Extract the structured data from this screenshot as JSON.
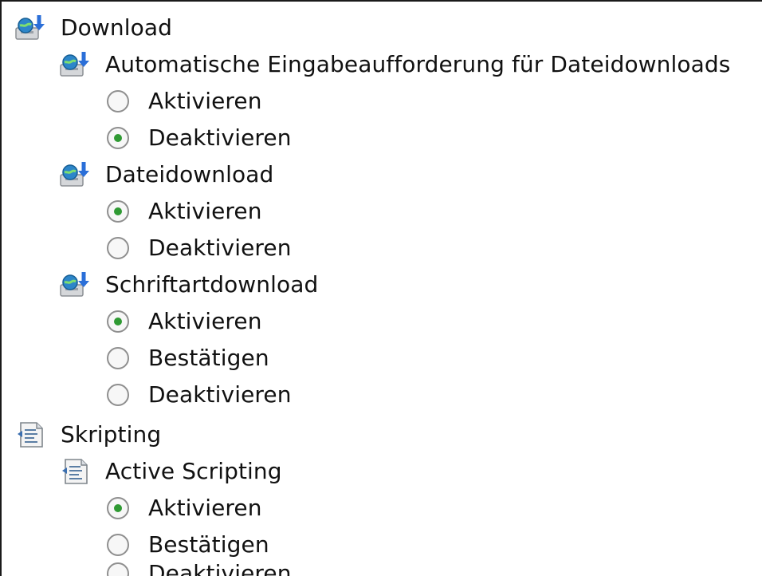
{
  "tree": {
    "download": {
      "label": "Download",
      "icon": "download-settings-icon",
      "settings": [
        {
          "label": "Automatische Eingabeaufforderung für Dateidownloads",
          "options": [
            {
              "label": "Aktivieren",
              "selected": false
            },
            {
              "label": "Deaktivieren",
              "selected": true
            }
          ]
        },
        {
          "label": "Dateidownload",
          "options": [
            {
              "label": "Aktivieren",
              "selected": true
            },
            {
              "label": "Deaktivieren",
              "selected": false
            }
          ]
        },
        {
          "label": "Schriftartdownload",
          "options": [
            {
              "label": "Aktivieren",
              "selected": true
            },
            {
              "label": "Bestätigen",
              "selected": false
            },
            {
              "label": "Deaktivieren",
              "selected": false
            }
          ]
        }
      ]
    },
    "scripting": {
      "label": "Skripting",
      "icon": "script-document-icon",
      "settings": [
        {
          "label": "Active Scripting",
          "options": [
            {
              "label": "Aktivieren",
              "selected": true
            },
            {
              "label": "Bestätigen",
              "selected": false
            },
            {
              "label": "Deaktivieren",
              "selected": false
            }
          ]
        }
      ]
    }
  },
  "colors": {
    "radio_dot": "#2f9a33",
    "radio_border": "#8f8f8f",
    "globe_blue": "#2d86c9",
    "arrow_blue": "#2b6fd8"
  }
}
